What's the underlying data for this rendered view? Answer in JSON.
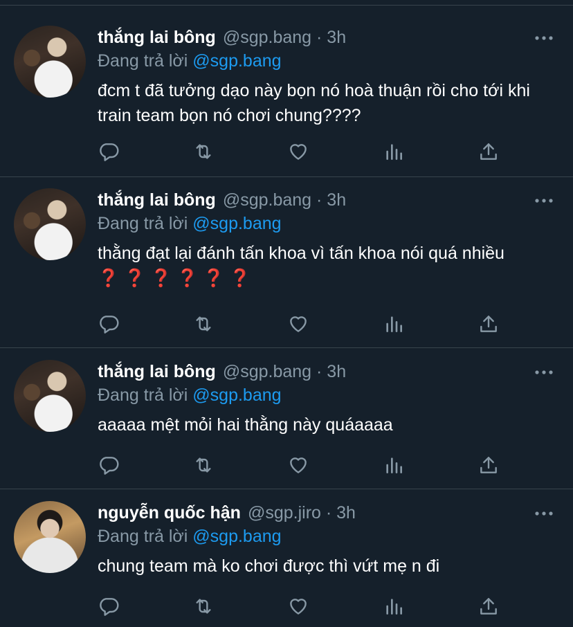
{
  "tweets": [
    {
      "display_name": "thắng lai bông",
      "handle": "@sgp.bang",
      "time": "3h",
      "reply_prefix": "Đang trả lời",
      "reply_to": "@sgp.bang",
      "text": "đcm t đã tưởng dạo này bọn nó hoà thuận rồi cho tới khi train team bọn nó chơi chung????",
      "emoji": ""
    },
    {
      "display_name": "thắng lai bông",
      "handle": "@sgp.bang",
      "time": "3h",
      "reply_prefix": "Đang trả lời",
      "reply_to": "@sgp.bang",
      "text": "thằng đạt lại đánh tấn khoa vì tấn khoa nói quá nhiều",
      "emoji": "❓ ❓ ❓ ❓ ❓ ❓"
    },
    {
      "display_name": "thắng lai bông",
      "handle": "@sgp.bang",
      "time": "3h",
      "reply_prefix": "Đang trả lời",
      "reply_to": "@sgp.bang",
      "text": "aaaaa mệt mỏi hai thằng này quáaaaa",
      "emoji": ""
    },
    {
      "display_name": "nguyễn quốc hận",
      "handle": "@sgp.jiro",
      "time": "3h",
      "reply_prefix": "Đang trả lời",
      "reply_to": "@sgp.bang",
      "text": "chung team mà ko chơi được thì vứt mẹ n đi",
      "emoji": ""
    }
  ],
  "colors": {
    "background": "#15202b",
    "secondary_text": "#8899a6",
    "mention": "#1d9bf0",
    "divider": "#38444d"
  },
  "icons": [
    "reply-icon",
    "retweet-icon",
    "like-icon",
    "analytics-icon",
    "share-icon",
    "more-icon"
  ]
}
